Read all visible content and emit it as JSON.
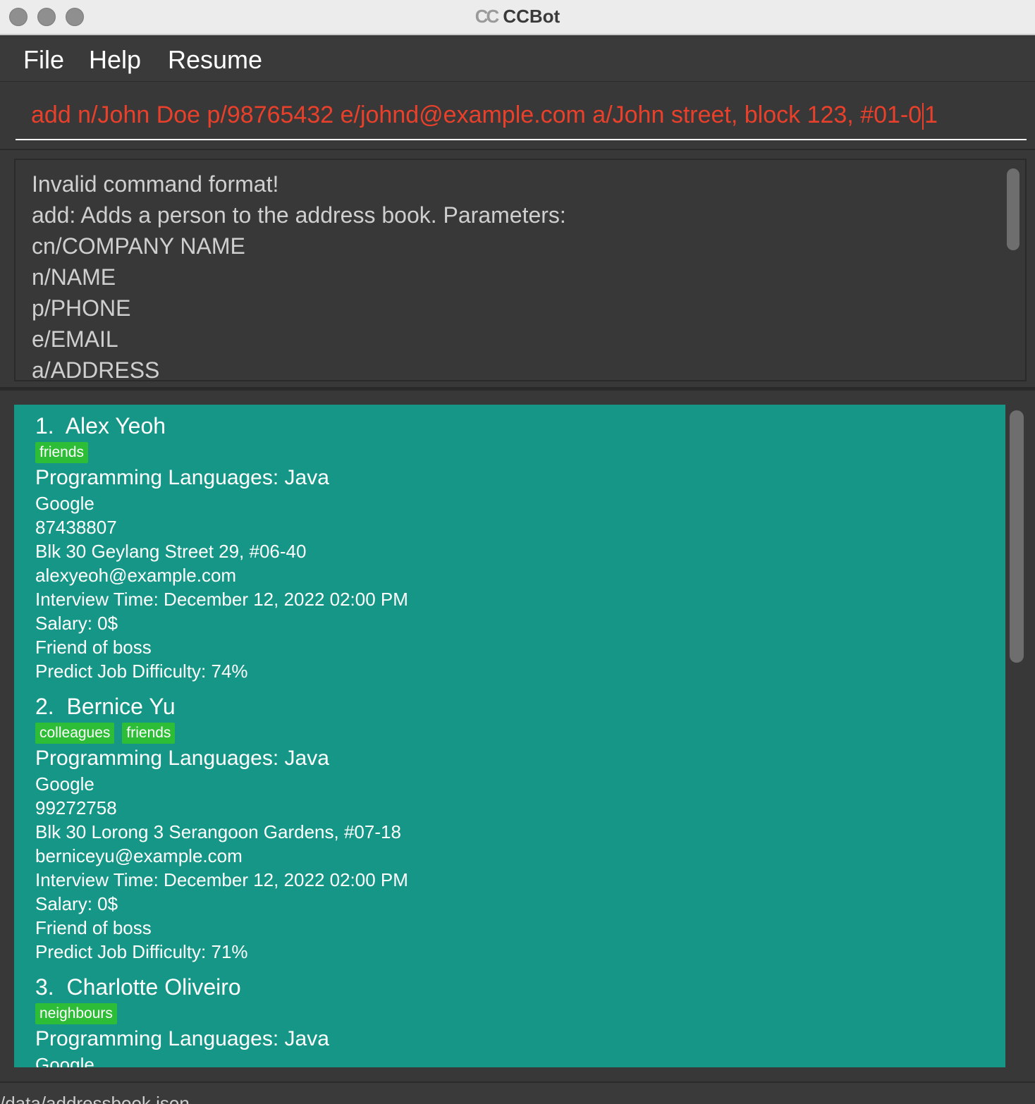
{
  "window": {
    "title": "CCBot"
  },
  "menu": {
    "file": "File",
    "help": "Help",
    "resume": "Resume"
  },
  "command": {
    "value_before_caret": "add n/John Doe p/98765432 e/johnd@example.com a/John street, block 123, #01-0",
    "value_after_caret": "1"
  },
  "result": {
    "lines": [
      "Invalid command format!",
      "add: Adds a person to the address book. Parameters:",
      "cn/COMPANY NAME",
      "n/NAME",
      "p/PHONE",
      "e/EMAIL",
      "a/ADDRESS"
    ]
  },
  "persons": [
    {
      "index": "1.",
      "name": "Alex Yeoh",
      "tags": [
        "friends"
      ],
      "languages": "Programming Languages: Java",
      "company": "Google",
      "phone": "87438807",
      "address": "Blk 30 Geylang Street 29, #06-40",
      "email": "alexyeoh@example.com",
      "interview": "Interview Time: December 12, 2022 02:00 PM",
      "salary": "Salary: 0$",
      "remark": "Friend of boss",
      "difficulty": "Predict Job Difficulty: 74%"
    },
    {
      "index": "2.",
      "name": "Bernice Yu",
      "tags": [
        "colleagues",
        "friends"
      ],
      "languages": "Programming Languages: Java",
      "company": "Google",
      "phone": "99272758",
      "address": "Blk 30 Lorong 3 Serangoon Gardens, #07-18",
      "email": "berniceyu@example.com",
      "interview": "Interview Time: December 12, 2022 02:00 PM",
      "salary": "Salary: 0$",
      "remark": "Friend of boss",
      "difficulty": "Predict Job Difficulty: 71%"
    },
    {
      "index": "3.",
      "name": "Charlotte Oliveiro",
      "tags": [
        "neighbours"
      ],
      "languages": "Programming Languages: Java",
      "company": "Google"
    }
  ],
  "status": {
    "path": "/data/addressbook.json"
  },
  "colors": {
    "card_bg": "#159687",
    "tag_bg": "#2ebd37",
    "command_text": "#e8402a"
  }
}
